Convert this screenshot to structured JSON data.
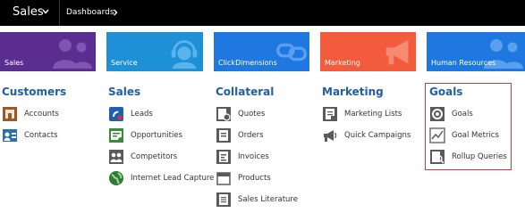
{
  "topbar": {
    "app_title": "Sales",
    "breadcrumb": "Dashboards"
  },
  "tiles": [
    {
      "label": "Sales",
      "color": "#5c2d91",
      "icon": "people-icon"
    },
    {
      "label": "Service",
      "color": "#1e90d8",
      "icon": "headset-icon"
    },
    {
      "label": "ClickDimensions",
      "color": "#1e78e0",
      "icon": "link-icon"
    },
    {
      "label": "Marketing",
      "color": "#f25c3d",
      "icon": "megaphone-icon"
    },
    {
      "label": "Human Resources",
      "color": "#1e78e0",
      "icon": "people-icon"
    }
  ],
  "groups": {
    "customers": {
      "title": "Customers",
      "items": [
        {
          "label": "Accounts",
          "icon": "accounts-icon"
        },
        {
          "label": "Contacts",
          "icon": "contacts-icon"
        }
      ]
    },
    "sales": {
      "title": "Sales",
      "items": [
        {
          "label": "Leads",
          "icon": "leads-icon"
        },
        {
          "label": "Opportunities",
          "icon": "opportunities-icon"
        },
        {
          "label": "Competitors",
          "icon": "competitors-icon"
        },
        {
          "label": "Internet Lead Capture",
          "icon": "globe-icon"
        }
      ]
    },
    "collateral": {
      "title": "Collateral",
      "items": [
        {
          "label": "Quotes",
          "icon": "quotes-icon"
        },
        {
          "label": "Orders",
          "icon": "orders-icon"
        },
        {
          "label": "Invoices",
          "icon": "invoices-icon"
        },
        {
          "label": "Products",
          "icon": "products-icon"
        },
        {
          "label": "Sales Literature",
          "icon": "sales-literature-icon"
        }
      ]
    },
    "marketing": {
      "title": "Marketing",
      "items": [
        {
          "label": "Marketing Lists",
          "icon": "marketing-lists-icon"
        },
        {
          "label": "Quick Campaigns",
          "icon": "quick-campaigns-icon"
        }
      ]
    },
    "goals": {
      "title": "Goals",
      "items": [
        {
          "label": "Goals",
          "icon": "target-icon"
        },
        {
          "label": "Goal Metrics",
          "icon": "goal-metrics-icon"
        },
        {
          "label": "Rollup Queries",
          "icon": "rollup-queries-icon"
        }
      ],
      "highlight_color": "#d33a3a"
    }
  }
}
